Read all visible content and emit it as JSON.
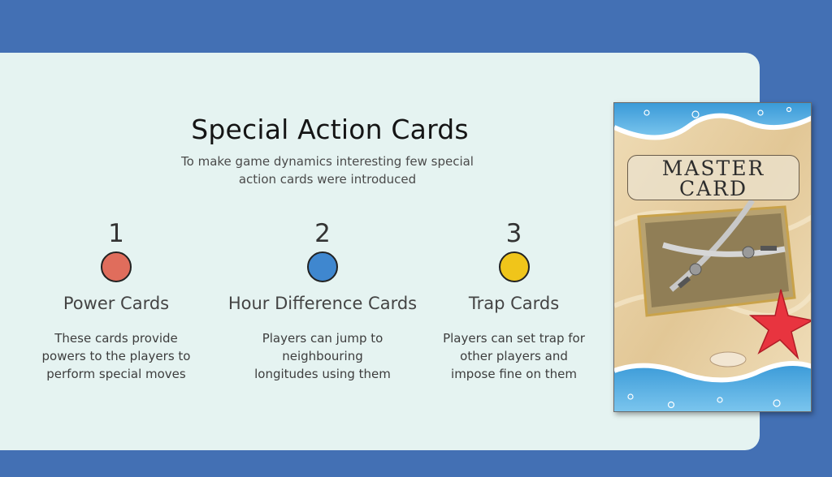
{
  "header": {
    "title": "Special Action Cards",
    "subtitle": "To make game dynamics interesting few special action cards were introduced"
  },
  "features": [
    {
      "number": "1",
      "name": "Power Cards",
      "description": "These cards provide powers to the players to perform special moves",
      "color": "#e06d5c"
    },
    {
      "number": "2",
      "name": "Hour Difference Cards",
      "description": "Players can jump to neighbouring longitudes using them",
      "color": "#3f87cf"
    },
    {
      "number": "3",
      "name": "Trap Cards",
      "description": "Players can set trap for other players and impose fine on them",
      "color": "#f0c51a"
    }
  ],
  "card": {
    "line1": "MASTER",
    "line2": "CARD"
  },
  "colors": {
    "background": "#4370b4",
    "panel": "#e5f3f1"
  }
}
